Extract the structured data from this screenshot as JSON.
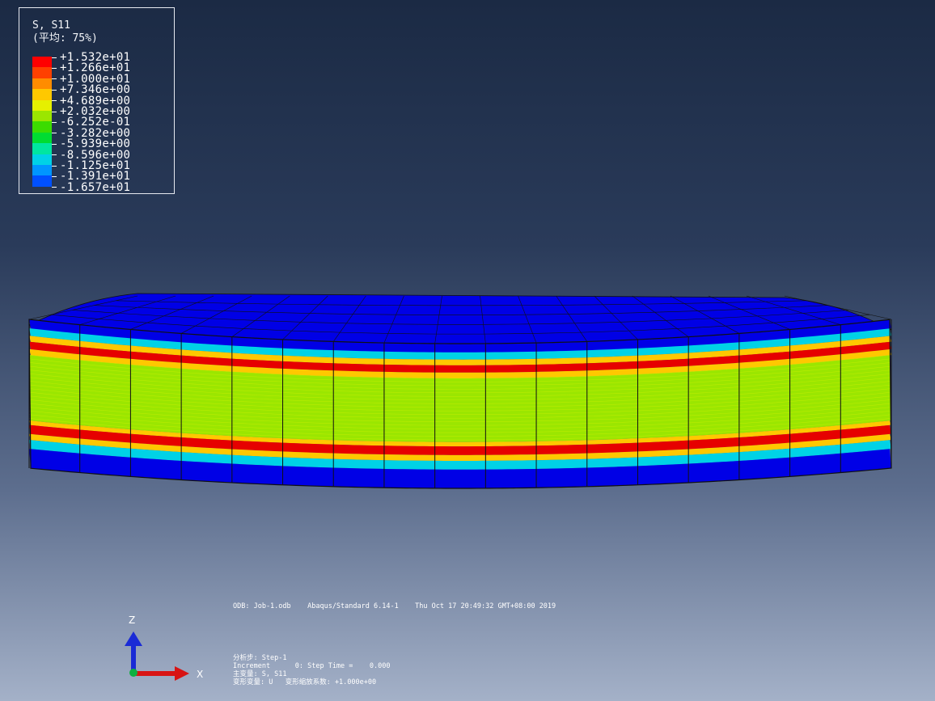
{
  "legend": {
    "title_line1": "S, S11",
    "title_line2": "(平均: 75%)",
    "entries": [
      {
        "label": "+1.532e+01",
        "color": "#ff0000"
      },
      {
        "label": "+1.266e+01",
        "color": "#ff4000"
      },
      {
        "label": "+1.000e+01",
        "color": "#ff8c00"
      },
      {
        "label": "+7.346e+00",
        "color": "#ffc800"
      },
      {
        "label": "+4.689e+00",
        "color": "#e6f000"
      },
      {
        "label": "+2.032e+00",
        "color": "#9be600"
      },
      {
        "label": "-6.252e-01",
        "color": "#3cdc00"
      },
      {
        "label": "-3.282e+00",
        "color": "#00dc32"
      },
      {
        "label": "-5.939e+00",
        "color": "#00e6a0"
      },
      {
        "label": "-8.596e+00",
        "color": "#00d2e6"
      },
      {
        "label": "-1.125e+01",
        "color": "#0096ff"
      },
      {
        "label": "-1.391e+01",
        "color": "#0050ff"
      },
      {
        "label": "-1.657e+01",
        "color": "#0000ff"
      }
    ]
  },
  "model_colors": {
    "top": "#0000e6",
    "band_outer": "#00d2e6",
    "band_mid": "#3cdc00",
    "band_hot": "#e60000",
    "band_warm": "#ffc800",
    "core": "#9be600",
    "mesh": "#111111"
  },
  "info": {
    "odb_line": "ODB: Job-1.odb    Abaqus/Standard 6.14-1    Thu Oct 17 20:49:32 GMT+08:00 2019",
    "step_line": "分析步: Step-1",
    "increment_line": "Increment      0: Step Time =    0.000",
    "primary_var_line": "主变量: S, S11",
    "deformed_line": "变形变量: U   变形缩放系数: +1.000e+00"
  },
  "triad": {
    "z_label": "Z",
    "x_label": "X"
  }
}
